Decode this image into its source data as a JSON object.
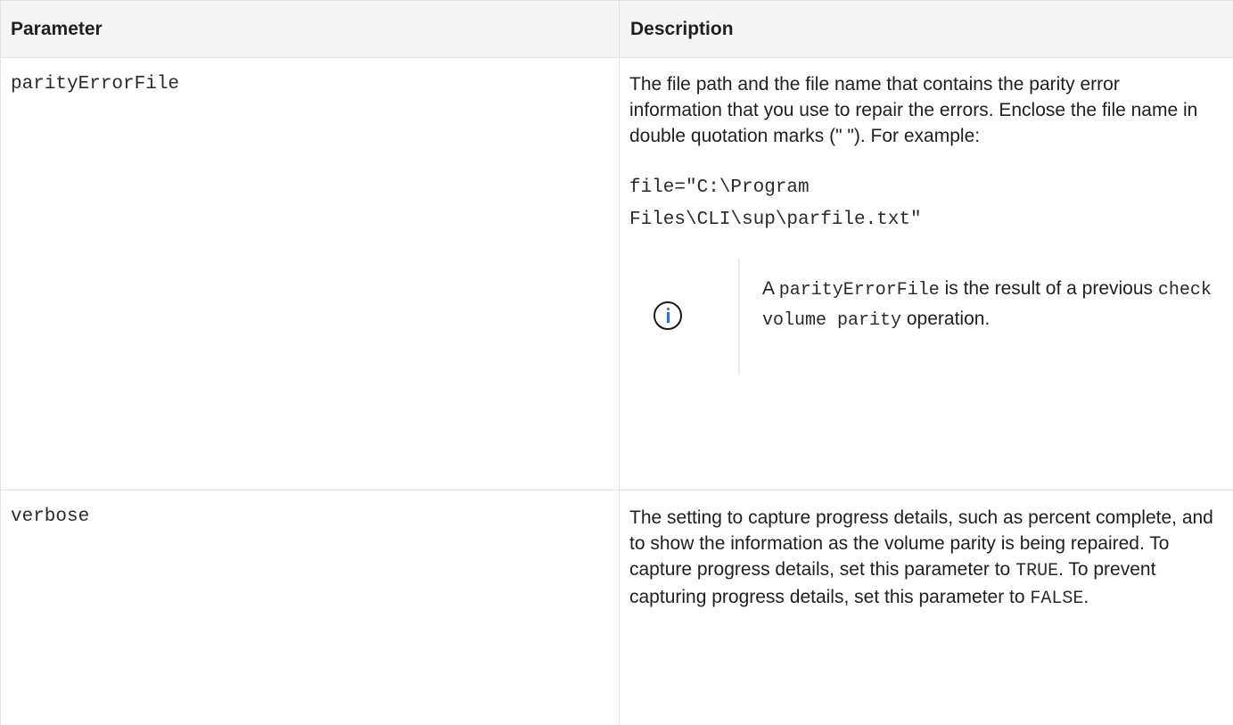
{
  "table": {
    "headers": {
      "parameter": "Parameter",
      "description": "Description"
    },
    "rows": [
      {
        "name": "parityErrorFile",
        "description": "The file path and the file name that contains the parity error information that you use to repair the errors. Enclose the file name in double quotation marks (\" \"). For example:",
        "example_line1": "file=\"C:\\Program",
        "example_line2": "Files\\CLI\\sup\\parfile.txt\"",
        "note": {
          "icon": "info-icon",
          "prefix": "A",
          "code1": "parityErrorFile",
          "middle": "is the result of a previous",
          "code2": "check volume parity",
          "suffix": "operation."
        }
      },
      {
        "name": "verbose",
        "description_part1": "The setting to capture progress details, such as percent complete, and to show the information as the volume parity is being repaired. To capture progress details, set this parameter to",
        "code_true": "TRUE",
        "description_part2": ". To prevent capturing progress details, set this parameter to",
        "code_false": "FALSE",
        "description_part3": "."
      }
    ]
  },
  "colors": {
    "border": "#e2e2e2",
    "header_bg": "#f5f5f5",
    "info_accent": "#1a73e8"
  }
}
